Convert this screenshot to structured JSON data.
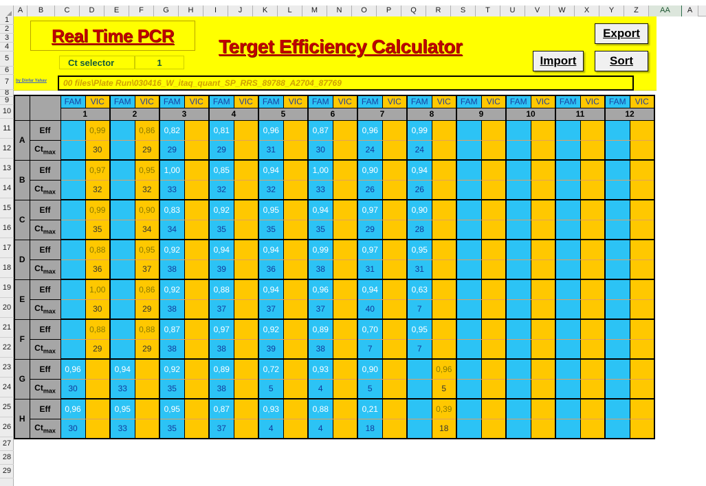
{
  "spreadsheet": {
    "column_headers": [
      "A",
      "B",
      "C",
      "D",
      "E",
      "F",
      "G",
      "H",
      "I",
      "J",
      "K",
      "L",
      "M",
      "N",
      "O",
      "P",
      "Q",
      "R",
      "S",
      "T",
      "U",
      "V",
      "W",
      "X",
      "Y",
      "Z",
      "AA",
      "A"
    ],
    "selected_column": "AA",
    "row_headers": [
      "1",
      "2",
      "3",
      "4",
      "5",
      "6",
      "7",
      "8",
      "9",
      "10",
      "11",
      "12",
      "13",
      "14",
      "15",
      "16",
      "17",
      "18",
      "19",
      "20",
      "21",
      "22",
      "23",
      "24",
      "25",
      "26",
      "27",
      "28",
      "29"
    ]
  },
  "header": {
    "title_main": "Real Time PCR",
    "title_sub": "Terget Efficiency Calculator",
    "ct_selector_label": "Ct selector",
    "ct_selector_value": "1",
    "attribution": "by Dinfar Yahav",
    "file_path": "00 files\\Plate Run\\030416_W_itaq_quant_SP_RRS_89788_A2704_87769",
    "buttons": {
      "export": "Export",
      "import": "Import",
      "sort": "Sort"
    }
  },
  "plate": {
    "dye_labels": {
      "fam": "FAM",
      "vic": "VIC"
    },
    "column_numbers": [
      "1",
      "2",
      "3",
      "4",
      "5",
      "6",
      "7",
      "8",
      "9",
      "10",
      "11",
      "12"
    ],
    "metric_labels": {
      "eff": "Eff",
      "ct_prefix": "Ct",
      "ct_suffix": "max"
    },
    "row_labels": [
      "A",
      "B",
      "C",
      "D",
      "E",
      "F",
      "G",
      "H"
    ],
    "colors": {
      "fam_fill": "#2cc3f5",
      "vic_fill": "#ffc800",
      "header_fill": "#a6a6a6",
      "banner_fill": "#ffff00",
      "title_color": "#c00000",
      "ct_selector_color": "#14593c"
    },
    "rows": [
      {
        "label": "A",
        "eff": [
          "",
          "0,99",
          "",
          "0,86",
          "0,82",
          "",
          "0,81",
          "",
          "0,96",
          "",
          "0,87",
          "",
          "0,96",
          "",
          "0,99",
          "",
          "",
          "",
          "",
          "",
          "",
          "",
          "",
          ""
        ],
        "ct": [
          "",
          "30",
          "",
          "29",
          "29",
          "",
          "29",
          "",
          "31",
          "",
          "30",
          "",
          "24",
          "",
          "24",
          "",
          "",
          "",
          "",
          "",
          "",
          "",
          "",
          ""
        ]
      },
      {
        "label": "B",
        "eff": [
          "",
          "0,97",
          "",
          "0,95",
          "1,00",
          "",
          "0,85",
          "",
          "0,94",
          "",
          "1,00",
          "",
          "0,90",
          "",
          "0,94",
          "",
          "",
          "",
          "",
          "",
          "",
          "",
          "",
          ""
        ],
        "ct": [
          "",
          "32",
          "",
          "32",
          "33",
          "",
          "32",
          "",
          "32",
          "",
          "33",
          "",
          "26",
          "",
          "26",
          "",
          "",
          "",
          "",
          "",
          "",
          "",
          "",
          ""
        ]
      },
      {
        "label": "C",
        "eff": [
          "",
          "0,99",
          "",
          "0,90",
          "0,83",
          "",
          "0,92",
          "",
          "0,95",
          "",
          "0,94",
          "",
          "0,97",
          "",
          "0,90",
          "",
          "",
          "",
          "",
          "",
          "",
          "",
          "",
          ""
        ],
        "ct": [
          "",
          "35",
          "",
          "34",
          "34",
          "",
          "35",
          "",
          "35",
          "",
          "35",
          "",
          "29",
          "",
          "28",
          "",
          "",
          "",
          "",
          "",
          "",
          "",
          "",
          ""
        ]
      },
      {
        "label": "D",
        "eff": [
          "",
          "0,88",
          "",
          "0,95",
          "0,92",
          "",
          "0,94",
          "",
          "0,94",
          "",
          "0,99",
          "",
          "0,97",
          "",
          "0,95",
          "",
          "",
          "",
          "",
          "",
          "",
          "",
          "",
          ""
        ],
        "ct": [
          "",
          "36",
          "",
          "37",
          "38",
          "",
          "39",
          "",
          "36",
          "",
          "38",
          "",
          "31",
          "",
          "31",
          "",
          "",
          "",
          "",
          "",
          "",
          "",
          "",
          ""
        ]
      },
      {
        "label": "E",
        "eff": [
          "",
          "1,00",
          "",
          "0,86",
          "0,92",
          "",
          "0,88",
          "",
          "0,94",
          "",
          "0,96",
          "",
          "0,94",
          "",
          "0,63",
          "",
          "",
          "",
          "",
          "",
          "",
          "",
          "",
          ""
        ],
        "ct": [
          "",
          "30",
          "",
          "29",
          "38",
          "",
          "37",
          "",
          "37",
          "",
          "37",
          "",
          "40",
          "",
          "7",
          "",
          "",
          "",
          "",
          "",
          "",
          "",
          "",
          ""
        ]
      },
      {
        "label": "F",
        "eff": [
          "",
          "0,88",
          "",
          "0,88",
          "0,87",
          "",
          "0,97",
          "",
          "0,92",
          "",
          "0,89",
          "",
          "0,70",
          "",
          "0,95",
          "",
          "",
          "",
          "",
          "",
          "",
          "",
          "",
          ""
        ],
        "ct": [
          "",
          "29",
          "",
          "29",
          "38",
          "",
          "38",
          "",
          "39",
          "",
          "38",
          "",
          "7",
          "",
          "7",
          "",
          "",
          "",
          "",
          "",
          "",
          "",
          "",
          ""
        ]
      },
      {
        "label": "G",
        "eff": [
          "0,96",
          "",
          "0,94",
          "",
          "0,92",
          "",
          "0,89",
          "",
          "0,72",
          "",
          "0,93",
          "",
          "0,90",
          "",
          "",
          "0,96",
          "",
          "",
          "",
          "",
          "",
          "",
          "",
          ""
        ],
        "ct": [
          "30",
          "",
          "33",
          "",
          "35",
          "",
          "38",
          "",
          "5",
          "",
          "4",
          "",
          "5",
          "",
          "",
          "5",
          "",
          "",
          "",
          "",
          "",
          "",
          "",
          ""
        ]
      },
      {
        "label": "H",
        "eff": [
          "0,96",
          "",
          "0,95",
          "",
          "0,95",
          "",
          "0,87",
          "",
          "0,93",
          "",
          "0,88",
          "",
          "0,21",
          "",
          "",
          "0,39",
          "",
          "",
          "",
          "",
          "",
          "",
          "",
          ""
        ],
        "ct": [
          "30",
          "",
          "33",
          "",
          "35",
          "",
          "37",
          "",
          "4",
          "",
          "4",
          "",
          "18",
          "",
          "",
          "18",
          "",
          "",
          "",
          "",
          "",
          "",
          "",
          ""
        ]
      }
    ]
  }
}
